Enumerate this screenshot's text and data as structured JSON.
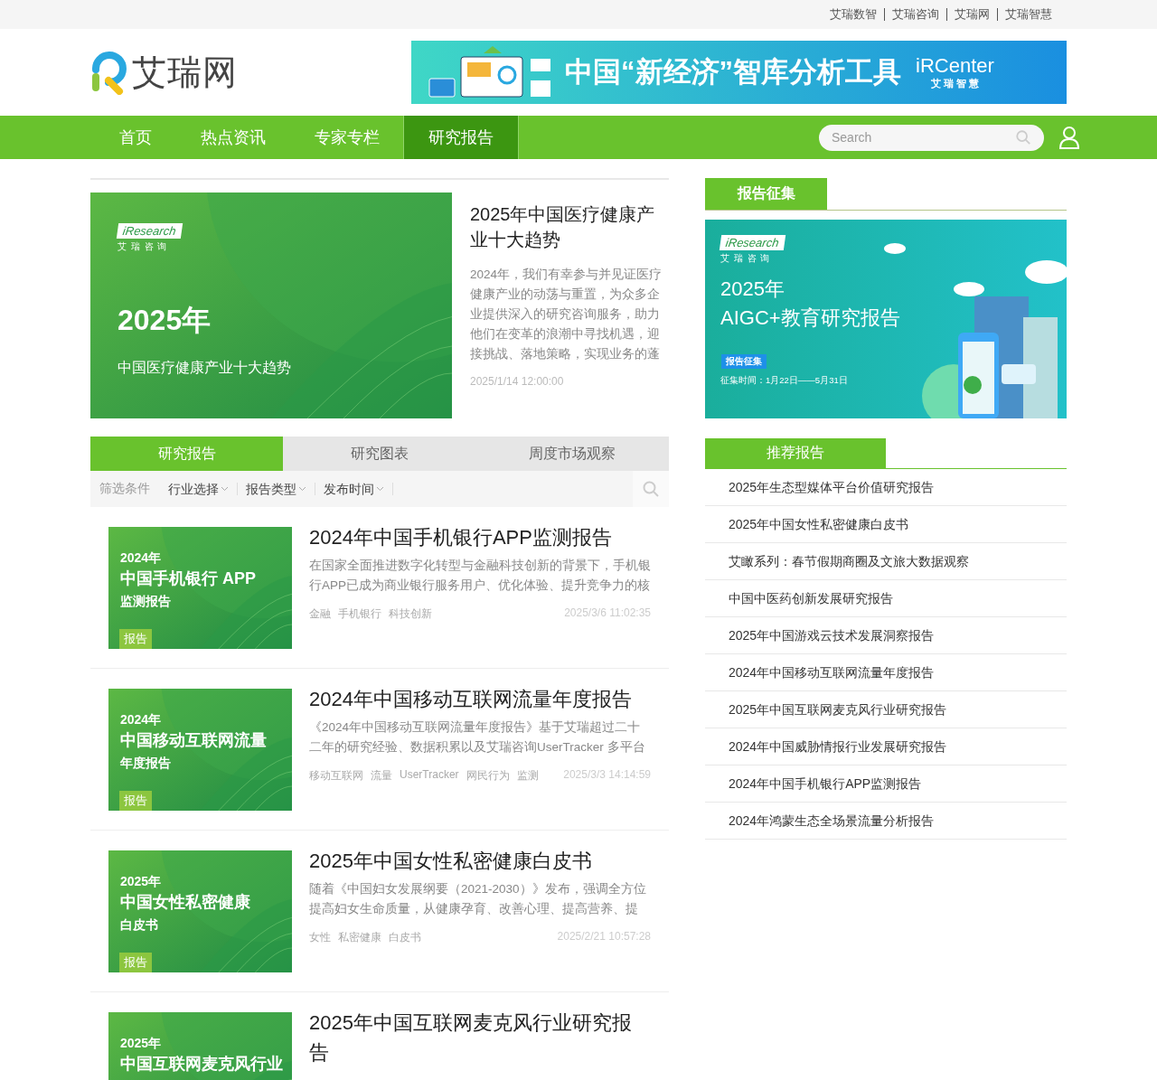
{
  "top_links": [
    "艾瑞数智",
    "艾瑞咨询",
    "艾瑞网",
    "艾瑞智慧"
  ],
  "logo": {
    "text": "艾瑞网"
  },
  "ad_banner": {
    "headline": "中国“新经济”智库分析工具",
    "brand": "iRCenter",
    "brand_sub": "艾 瑞 智 慧"
  },
  "nav": {
    "items": [
      {
        "label": "首页",
        "selected": false
      },
      {
        "label": "热点资讯",
        "selected": false
      },
      {
        "label": "专家专栏",
        "selected": false
      },
      {
        "label": "研究报告",
        "selected": true
      }
    ],
    "search": {
      "placeholder": "Search"
    }
  },
  "featured": {
    "thumb": {
      "logo": "iResearch",
      "logo_sub": "艾 瑞 咨 询",
      "year": "2025年",
      "subtitle": "中国医疗健康产业十大趋势"
    },
    "title": "2025年中国医疗健康产业十大趋势",
    "summary": "2024年，我们有幸参与并见证医疗健康产业的动荡与重置，为众多企业提供深入的研究咨询服务，助力他们在变革的浪潮中寻找机遇，迎接挑战、落地策略，实现业务的蓬",
    "date": "2025/1/14 12:00:00"
  },
  "tabs": [
    {
      "label": "研究报告",
      "selected": true
    },
    {
      "label": "研究图表",
      "selected": false
    },
    {
      "label": "周度市场观察",
      "selected": false
    }
  ],
  "filters": {
    "label": "筛选条件",
    "options": [
      "行业选择",
      "报告类型",
      "发布时间"
    ]
  },
  "articles": [
    {
      "thumb": {
        "lines": [
          "2024年",
          "中国手机银行 APP",
          "监测报告"
        ],
        "badge": "报告"
      },
      "title": "2024年中国手机银行APP监测报告",
      "summary": "在国家全面推进数字化转型与金融科技创新的背景下，手机银行APP已成为商业银行服务用户、优化体验、提升竞争力的核",
      "tags": [
        "金融",
        "手机银行",
        "科技创新"
      ],
      "date": "2025/3/6 11:02:35"
    },
    {
      "thumb": {
        "lines": [
          "2024年",
          "中国移动互联网流量",
          "年度报告"
        ],
        "badge": "报告"
      },
      "title": "2024年中国移动互联网流量年度报告",
      "summary": "《2024年中国移动互联网流量年度报告》基于艾瑞超过二十二年的研究经验、数据积累以及艾瑞咨询UserTracker 多平台",
      "tags": [
        "移动互联网",
        "流量",
        "UserTracker",
        "网民行为",
        "监测"
      ],
      "date": "2025/3/3 14:14:59"
    },
    {
      "thumb": {
        "lines": [
          "2025年",
          "中国女性私密健康",
          "白皮书"
        ],
        "badge": "报告"
      },
      "title": "2025年中国女性私密健康白皮书",
      "summary": "随着《中国妇女发展纲要（2021-2030）》发布，强调全方位提高妇女生命质量，从健康孕育、改善心理、提高营养、提",
      "tags": [
        "女性",
        "私密健康",
        "白皮书"
      ],
      "date": "2025/2/21 10:57:28"
    },
    {
      "thumb": {
        "lines": [
          "2025年",
          "中国互联网麦克风行业"
        ]
      },
      "title": "2025年中国互联网麦克风行业研究报告"
    }
  ],
  "sidebar": {
    "collect": {
      "title": "报告征集",
      "banner": {
        "logo": "iResearch",
        "logo_sub": "艾 瑞 咨 询",
        "year": "2025年",
        "title": "AIGC+教育研究报告",
        "badge": "报告征集",
        "period": "征集时间：1月22日——5月31日"
      }
    },
    "recommended": {
      "title": "推荐报告",
      "items": [
        "2025年生态型媒体平台价值研究报告",
        "2025年中国女性私密健康白皮书",
        "艾瞰系列：春节假期商圈及文旅大数据观察",
        "中国中医药创新发展研究报告",
        "2025年中国游戏云技术发展洞察报告",
        "2024年中国移动互联网流量年度报告",
        "2025年中国互联网麦克风行业研究报告",
        "2024年中国威胁情报行业发展研究报告",
        "2024年中国手机银行APP监测报告",
        "2024年鸿蒙生态全场景流量分析报告"
      ]
    }
  }
}
